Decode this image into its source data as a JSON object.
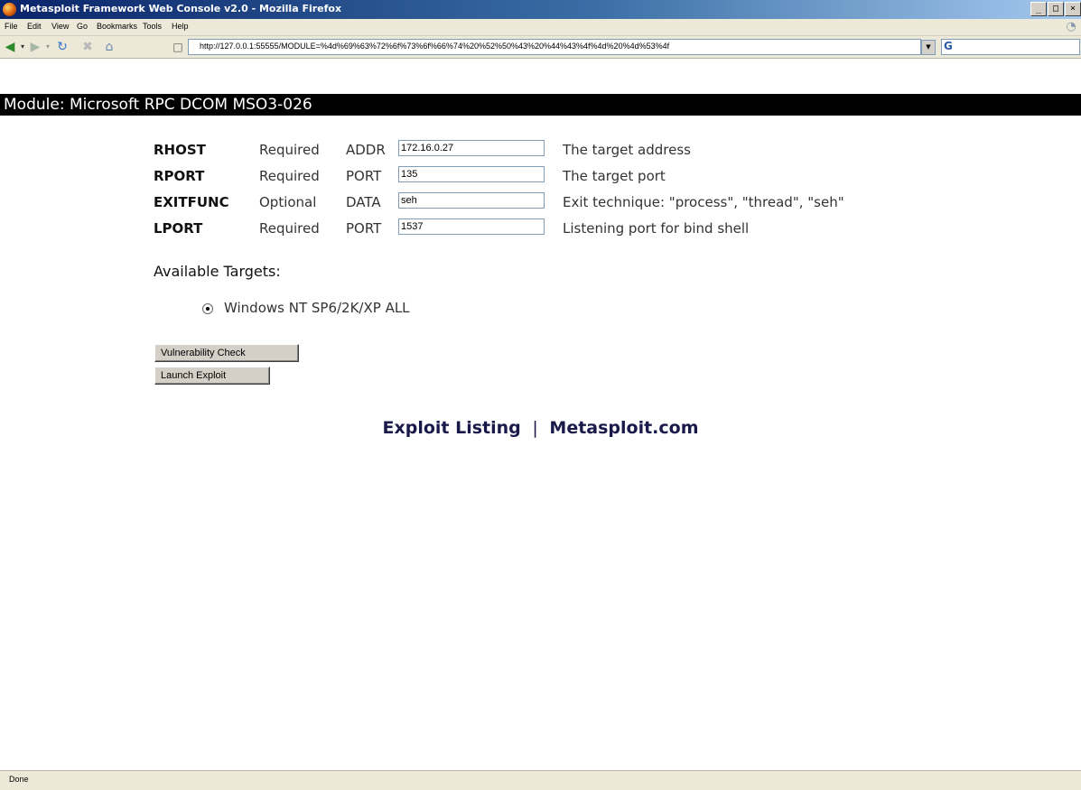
{
  "window": {
    "title": "Metasploit Framework Web Console v2.0 - Mozilla Firefox",
    "controls": [
      "_",
      "□",
      "×"
    ]
  },
  "menu": [
    "File",
    "Edit",
    "View",
    "Go",
    "Bookmarks",
    "Tools",
    "Help"
  ],
  "nav": {
    "url": "http://127.0.0.1:55555/MODULE=%4d%69%63%72%6f%73%6f%66%74%20%52%50%43%20%44%43%4f%4d%20%4d%53%4f"
  },
  "module": {
    "title": "Module: Microsoft RPC DCOM MSO3-026"
  },
  "options": [
    {
      "name": "RHOST",
      "required": "Required",
      "type": "ADDR",
      "value": "172.16.0.27",
      "description": "The target address"
    },
    {
      "name": "RPORT",
      "required": "Required",
      "type": "PORT",
      "value": "135",
      "description": "The target port"
    },
    {
      "name": "EXITFUNC",
      "required": "Optional",
      "type": "DATA",
      "value": "seh",
      "description": "Exit technique: \"process\", \"thread\", \"seh\""
    },
    {
      "name": "LPORT",
      "required": "Required",
      "type": "PORT",
      "value": "1537",
      "description": "Listening port for bind shell"
    }
  ],
  "targets": {
    "heading": "Available Targets:",
    "items": [
      {
        "label": "Windows NT SP6/2K/XP ALL",
        "selected": true
      }
    ]
  },
  "buttons": {
    "check": "Vulnerability Check",
    "launch": "Launch Exploit"
  },
  "footer": {
    "exploit_listing": "Exploit Listing",
    "separator": "|",
    "site": "Metasploit.com"
  },
  "status": "Done"
}
